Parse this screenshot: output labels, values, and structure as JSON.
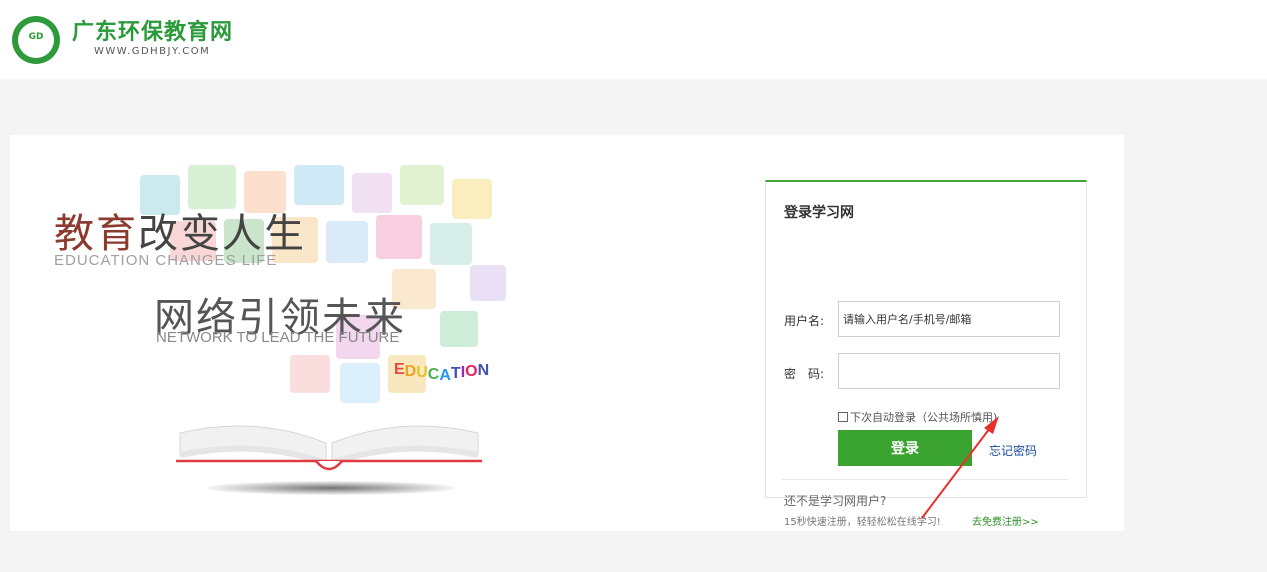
{
  "header": {
    "logo_badge_text": "GD",
    "site_name": "广东环保教育网",
    "site_url": "WWW.GDHBJY.COM"
  },
  "banner": {
    "slogan_line1_part1": "教育",
    "slogan_line1_part2": "改变人生",
    "slogan_line1_en": "EDUCATION CHANGES LIFE",
    "slogan_line2": "网络引领未来",
    "slogan_line2_en": "NETWORK TO LEAD THE FUTURE",
    "education_letters": [
      "E",
      "D",
      "U",
      "C",
      "A",
      "T",
      "I",
      "O",
      "N"
    ],
    "education_colors": [
      "#e8483c",
      "#f0a020",
      "#e5c32a",
      "#4caf50",
      "#2196f3",
      "#3f51b5",
      "#9c27b0",
      "#e91e63",
      "#3f51b5"
    ]
  },
  "login": {
    "title": "登录学习网",
    "username_label": "用户名:",
    "username_placeholder": "请输入用户名/手机号/邮箱",
    "password_label": "密　码:",
    "password_value": "",
    "remember_label": "下次自动登录（公共场所慎用)",
    "remember_checked": false,
    "login_button": "登录",
    "forgot_link": "忘记密码",
    "not_user_text": "还不是学习网用户?",
    "quick_register_text": "15秒快速注册，轻轻松松在线学习!",
    "register_link": "去免费注册>>"
  },
  "colors": {
    "brand_green": "#2a9a3a",
    "button_green": "#3aa22e",
    "accent_red": "#e0393e",
    "link_blue": "#1a4fa0"
  }
}
